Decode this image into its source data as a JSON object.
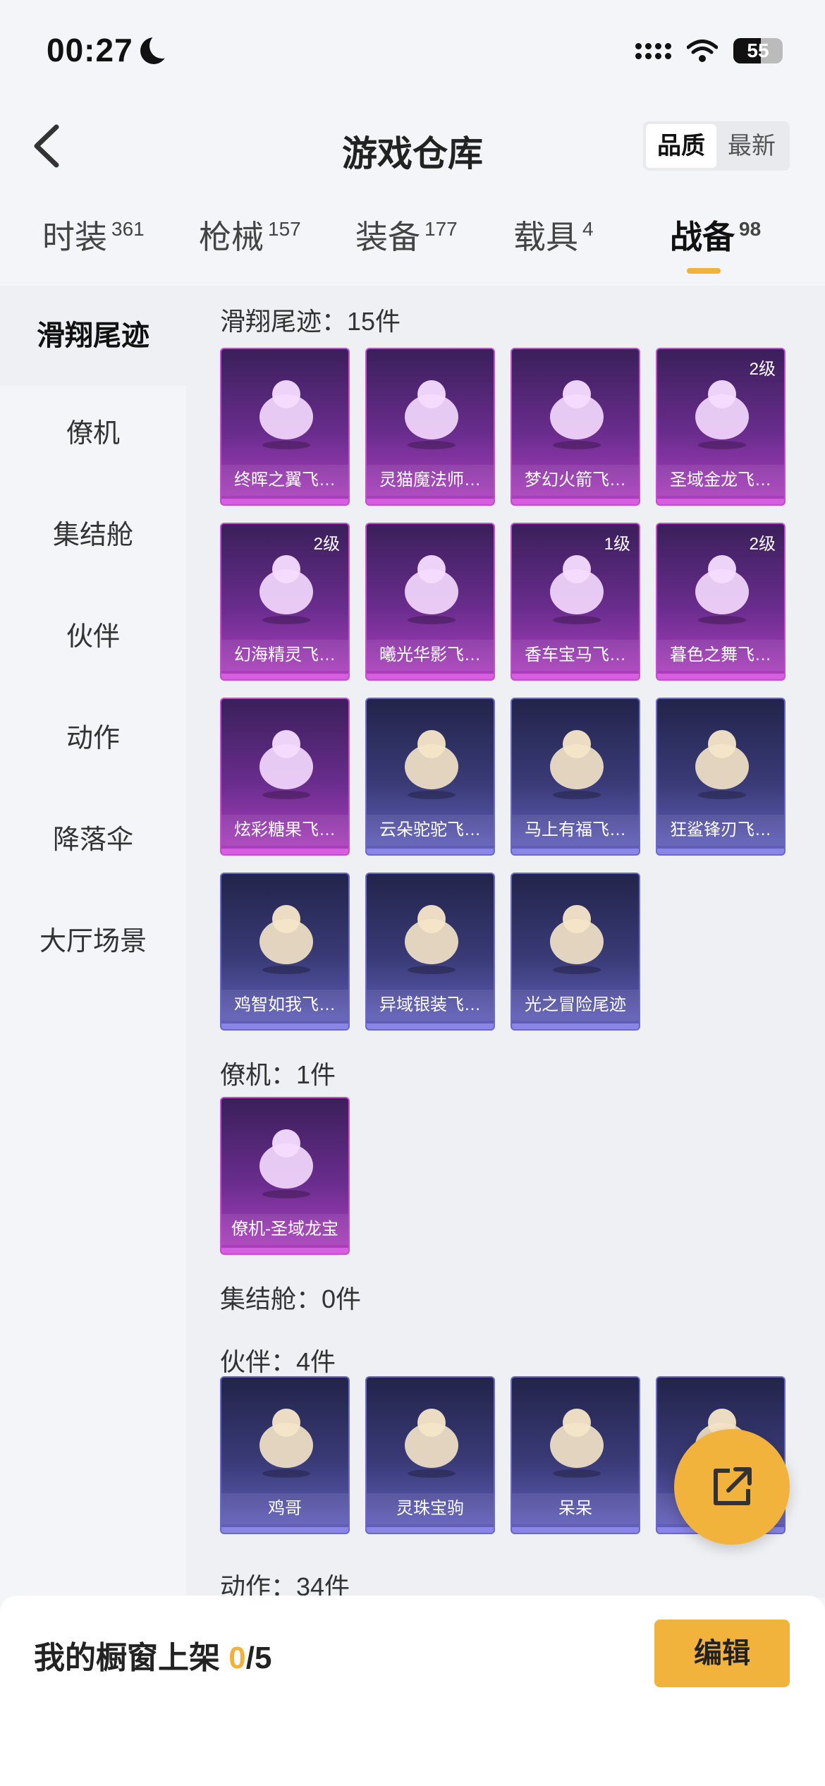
{
  "status_bar": {
    "time": "00:27",
    "battery": "55",
    "battery_level": 0.55
  },
  "header": {
    "title": "游戏仓库",
    "sort_options": [
      "品质",
      "最新"
    ],
    "sort_selected": "品质"
  },
  "tabs": [
    {
      "label": "时装",
      "count": "361"
    },
    {
      "label": "枪械",
      "count": "157"
    },
    {
      "label": "装备",
      "count": "177"
    },
    {
      "label": "载具",
      "count": "4"
    },
    {
      "label": "战备",
      "count": "98",
      "active": true
    }
  ],
  "sidebar": {
    "items": [
      "滑翔尾迹",
      "僚机",
      "集结舱",
      "伙伴",
      "动作",
      "降落伞",
      "大厅场景"
    ],
    "active": "滑翔尾迹"
  },
  "sections": [
    {
      "title": "滑翔尾迹：15件",
      "items": [
        {
          "name": "终晖之翼飞…",
          "rarity": "purple",
          "icon": "wing-trail-icon"
        },
        {
          "name": "灵猫魔法师…",
          "rarity": "purple",
          "icon": "cat-icon"
        },
        {
          "name": "梦幻火箭飞…",
          "rarity": "purple",
          "icon": "rocket-glider-icon"
        },
        {
          "name": "圣域金龙飞…",
          "rarity": "purple",
          "icon": "dragon-icon",
          "level": "2级"
        },
        {
          "name": "幻海精灵飞…",
          "rarity": "purple",
          "icon": "jellyfish-icon",
          "level": "2级"
        },
        {
          "name": "曦光华影飞…",
          "rarity": "purple",
          "icon": "flower-icon"
        },
        {
          "name": "香车宝马飞…",
          "rarity": "purple",
          "icon": "carriage-icon",
          "level": "1级"
        },
        {
          "name": "暮色之舞飞…",
          "rarity": "purple",
          "icon": "blade-icon",
          "level": "2级"
        },
        {
          "name": "炫彩糖果飞…",
          "rarity": "purple",
          "icon": "candy-icon"
        },
        {
          "name": "云朵驼驼飞…",
          "rarity": "blue",
          "icon": "alpaca-icon"
        },
        {
          "name": "马上有福飞…",
          "rarity": "blue",
          "icon": "horse-icon"
        },
        {
          "name": "狂鲨锋刃飞…",
          "rarity": "blue",
          "icon": "shark-icon"
        },
        {
          "name": "鸡智如我飞…",
          "rarity": "blue",
          "icon": "chicken-icon"
        },
        {
          "name": "异域银装飞…",
          "rarity": "blue",
          "icon": "silver-wing-icon"
        },
        {
          "name": "光之冒险尾迹",
          "rarity": "blue",
          "icon": "smoke-trail-icon"
        }
      ]
    },
    {
      "title": "僚机：1件",
      "items": [
        {
          "name": "僚机-圣域龙宝",
          "rarity": "purple",
          "icon": "baby-dragon-icon"
        }
      ]
    },
    {
      "title": "集结舱：0件",
      "items": []
    },
    {
      "title": "伙伴：4件",
      "items": [
        {
          "name": "鸡哥",
          "rarity": "blue",
          "icon": "chicken-icon"
        },
        {
          "name": "灵珠宝驹",
          "rarity": "blue",
          "icon": "pony-icon"
        },
        {
          "name": "呆呆",
          "rarity": "blue",
          "icon": "chick-icon"
        },
        {
          "name": "",
          "rarity": "blue",
          "icon": "pet-icon"
        }
      ]
    },
    {
      "title": "动作：34件",
      "items": []
    }
  ],
  "bottom": {
    "label": "我的橱窗上架 ",
    "shelf_count": "0",
    "shelf_total": "/5",
    "edit_label": "编辑"
  },
  "colors": {
    "accent": "#f2b33c",
    "purple_card": "#6a2d8e",
    "blue_card": "#3a3b78"
  }
}
